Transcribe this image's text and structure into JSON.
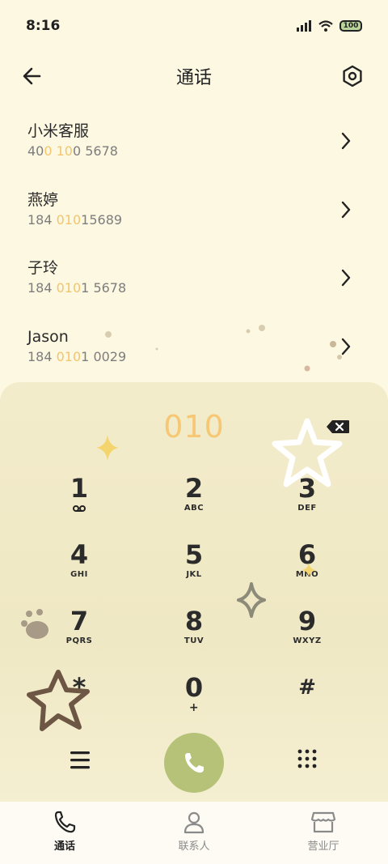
{
  "status_bar": {
    "time": "8:16",
    "battery": "100"
  },
  "header": {
    "title": "通话"
  },
  "calls": [
    {
      "name": "小米客服",
      "num_parts": [
        "40",
        "0 10",
        "0 5678"
      ]
    },
    {
      "name": "燕婷",
      "num_parts": [
        "184 ",
        "010",
        "15689"
      ]
    },
    {
      "name": "子玲",
      "num_parts": [
        "184 ",
        "010",
        "1 5678"
      ]
    },
    {
      "name": "Jason",
      "num_parts": [
        "184 ",
        "010",
        "1 0029"
      ]
    }
  ],
  "dialer": {
    "input": "010",
    "keys": [
      {
        "digit": "1",
        "letters": ""
      },
      {
        "digit": "2",
        "letters": "ABC"
      },
      {
        "digit": "3",
        "letters": "DEF"
      },
      {
        "digit": "4",
        "letters": "GHI"
      },
      {
        "digit": "5",
        "letters": "JKL"
      },
      {
        "digit": "6",
        "letters": "MNO"
      },
      {
        "digit": "7",
        "letters": "PQRS"
      },
      {
        "digit": "8",
        "letters": "TUV"
      },
      {
        "digit": "9",
        "letters": "WXYZ"
      },
      {
        "digit": "*",
        "letters": ""
      },
      {
        "digit": "0",
        "letters": "+"
      },
      {
        "digit": "#",
        "letters": ""
      }
    ]
  },
  "tabs": [
    {
      "label": "通话",
      "icon": "phone-icon",
      "active": true
    },
    {
      "label": "联系人",
      "icon": "person-icon",
      "active": false
    },
    {
      "label": "营业厅",
      "icon": "store-icon",
      "active": false
    }
  ],
  "colors": {
    "accent": "#f6c774",
    "call_button": "#b5c278",
    "background": "#fdf8e2"
  }
}
